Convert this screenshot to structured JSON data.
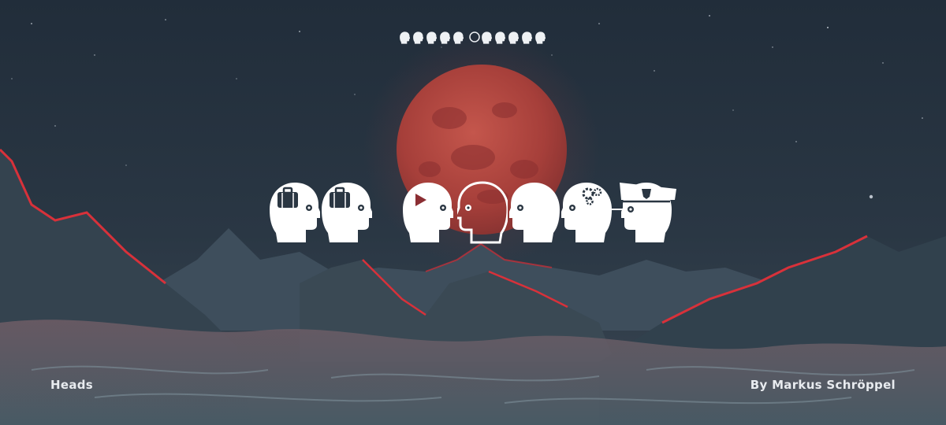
{
  "font": {
    "name": "Heads",
    "author_credit": "By Markus Schröppel"
  },
  "icons": [
    "head-briefcase-icon",
    "head-briefcase-icon",
    "head-play-icon",
    "head-outline-icon",
    "head-profile-icon",
    "head-gears-icon",
    "head-police-cap-icon"
  ],
  "colors": {
    "sky": "#1f2b38",
    "moon": "#b5463f",
    "mountain_rim": "#d8313a",
    "glyph": "#ffffff"
  }
}
